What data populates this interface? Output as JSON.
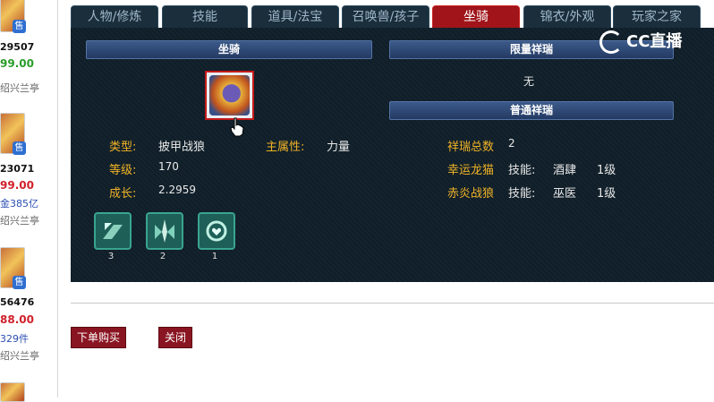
{
  "listing": [
    {
      "id": "29507",
      "price": "99.00",
      "price_color": "#2a9d2a",
      "meta": "",
      "meta_color": "#333",
      "server": "绍兴兰亭"
    },
    {
      "id": "23071",
      "price": "99.00",
      "price_color": "#d0202a",
      "meta": "金385亿",
      "meta_color": "#2b4fb3",
      "server": "绍兴兰亭"
    },
    {
      "id": "56476",
      "price": "88.00",
      "price_color": "#d0202a",
      "meta": "329件",
      "meta_color": "#2b4fb3",
      "server": "绍兴兰亭"
    }
  ],
  "sell_badge": "售",
  "tabs": [
    "人物/修炼",
    "技能",
    "道具/法宝",
    "召唤兽/孩子",
    "坐骑",
    "锦衣/外观",
    "玩家之家"
  ],
  "active_tab": "坐骑",
  "panel": {
    "mount_header": "坐骑",
    "limited_header": "限量祥瑞",
    "limited_value": "无",
    "normal_header": "普通祥瑞"
  },
  "mount": {
    "type_label": "类型:",
    "type_value": "披甲战狼",
    "main_attr_label": "主属性:",
    "main_attr_value": "力量",
    "level_label": "等级:",
    "level_value": "170",
    "growth_label": "成长:",
    "growth_value": "2.2959"
  },
  "xiangrui": {
    "total_label": "祥瑞总数",
    "total_value": "2",
    "items": [
      {
        "name": "幸运龙猫",
        "skill_label": "技能:",
        "skill": "酒肆",
        "level": "1级"
      },
      {
        "name": "赤炎战狼",
        "skill_label": "技能:",
        "skill": "巫医",
        "level": "1级"
      }
    ]
  },
  "skills": [
    {
      "icon": "mount-skill-icon-1",
      "count": "3"
    },
    {
      "icon": "mount-skill-icon-2",
      "count": "2"
    },
    {
      "icon": "mount-skill-icon-3",
      "count": "1"
    }
  ],
  "actions": {
    "buy_label": "下单购买",
    "close_label": "关闭"
  },
  "watermark": "CC直播"
}
